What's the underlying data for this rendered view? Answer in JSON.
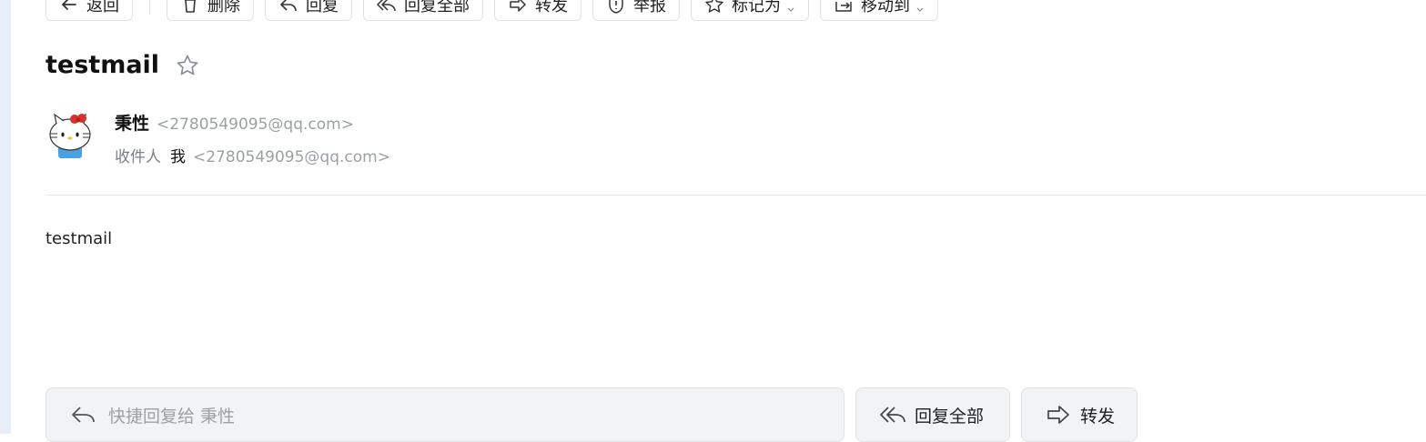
{
  "toolbar": {
    "back_label": "返回",
    "delete_label": "删除",
    "reply_label": "回复",
    "reply_all_label": "回复全部",
    "forward_label": "转发",
    "report_label": "举报",
    "mark_as_label": "标记为",
    "move_to_label": "移动到"
  },
  "message": {
    "subject": "testmail",
    "sender_name": "秉性",
    "sender_email": "<2780549095@qq.com>",
    "recipient_label": "收件人",
    "recipient_name": "我",
    "recipient_email": "<2780549095@qq.com>",
    "body": "testmail"
  },
  "quick_reply": {
    "placeholder": "快捷回复给 秉性",
    "reply_all_label": "回复全部",
    "forward_label": "转发"
  },
  "icons": {
    "back": "arrow-left-icon",
    "delete": "trash-icon",
    "reply": "reply-icon",
    "reply_all": "reply-all-icon",
    "forward": "forward-icon",
    "report": "shield-alert-icon",
    "mark": "star-icon",
    "move": "move-icon",
    "favorite": "star-outline-icon",
    "avatar": "hello-kitty-avatar"
  },
  "colors": {
    "accent_border": "#dfe1e5",
    "muted_text": "#9aa0a6",
    "quick_bar_bg": "#f2f3f5",
    "rail": "#e8eef8"
  }
}
